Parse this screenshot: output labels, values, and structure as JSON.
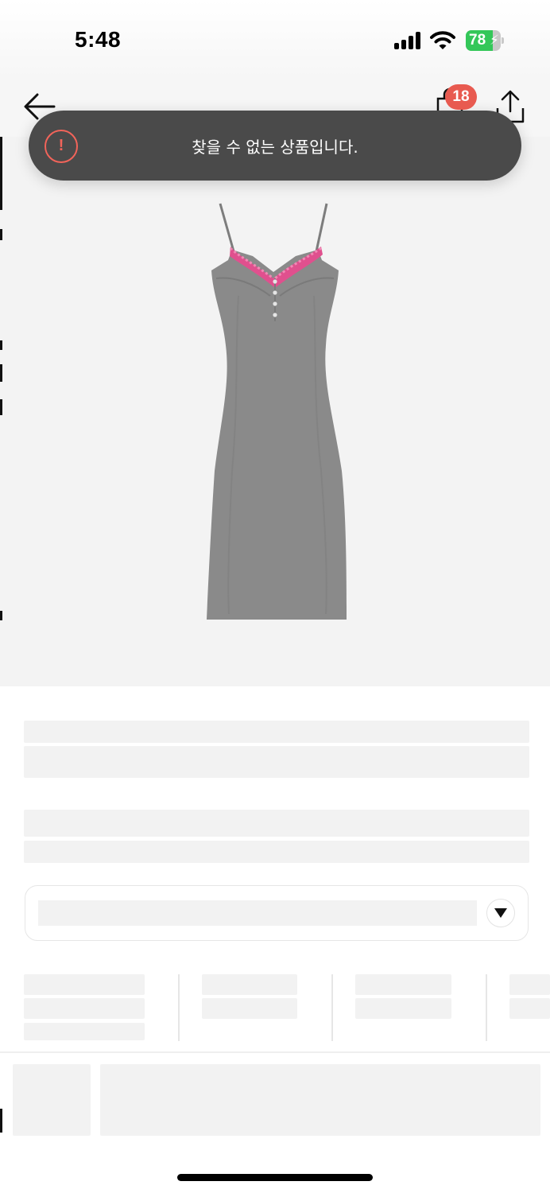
{
  "status_bar": {
    "time": "5:48",
    "battery_level": "78",
    "battery_charging_glyph": "⚡",
    "signal_icon": "cellular-signal-icon",
    "wifi_icon": "wifi-icon"
  },
  "nav": {
    "back_icon": "arrow-left-icon",
    "cart_icon": "shopping-bag-icon",
    "cart_count": "18",
    "share_icon": "share-icon"
  },
  "toast": {
    "icon_glyph": "!",
    "message": "찾을 수 없는 상품입니다."
  },
  "product": {
    "image_subject": "grey sleeveless slip dress with pink lace trim",
    "colors": {
      "dress": "#8a8a8a",
      "lace": "#e0508e",
      "background": "#f3f3f3"
    }
  },
  "colors": {
    "toast_bg": "#4a4a4a",
    "alert_accent": "#f2645a",
    "badge": "#e85a50",
    "skeleton": "#f2f2f2"
  }
}
